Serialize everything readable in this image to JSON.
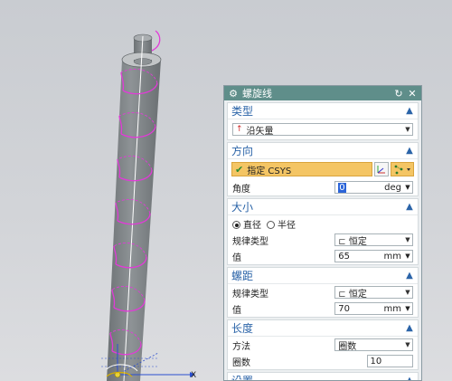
{
  "dialog": {
    "title": "螺旋线",
    "sections": {
      "type": {
        "header": "类型",
        "select_value": "沿矢量"
      },
      "direction": {
        "header": "方向",
        "csys_label": "指定 CSYS",
        "angle_label": "角度",
        "angle_value": "0",
        "angle_unit": "deg"
      },
      "size": {
        "header": "大小",
        "radio_diameter": "直径",
        "radio_radius": "半径",
        "law_type_label": "规律类型",
        "law_type_value": "恒定",
        "value_label": "值",
        "value": "65",
        "unit": "mm"
      },
      "pitch": {
        "header": "螺距",
        "law_type_label": "规律类型",
        "law_type_value": "恒定",
        "value_label": "值",
        "value": "70",
        "unit": "mm"
      },
      "length": {
        "header": "长度",
        "method_label": "方法",
        "method_value": "圈数",
        "turns_label": "圈数",
        "turns_value": "10"
      },
      "settings": {
        "header": "设置"
      }
    }
  },
  "viewport": {
    "axis_x_label": "X"
  },
  "colors": {
    "title_bar": "#5f8e8a",
    "section_header_text": "#2b64a8",
    "csys_highlight": "#f4c564",
    "helix": "#e23ad8",
    "cylinder": "#7c8184"
  }
}
